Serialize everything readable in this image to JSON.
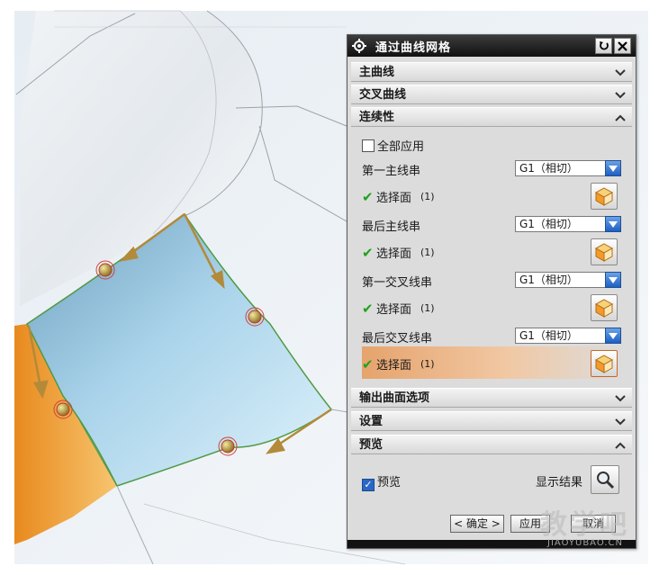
{
  "dialog": {
    "title": "通过曲线网格",
    "icon": "gear-icon",
    "reset_icon": "reset-icon",
    "close_icon": "close-icon"
  },
  "sections": {
    "primary_curves": "主曲线",
    "cross_curves": "交叉曲线",
    "continuity": "连续性",
    "output_options": "输出曲面选项",
    "settings": "设置",
    "preview": "预览"
  },
  "continuity": {
    "apply_all_label": "全部应用",
    "apply_all_checked": false,
    "rows": [
      {
        "label": "第一主线串",
        "value": "G1（相切）",
        "select_label": "选择面",
        "count": "(1)"
      },
      {
        "label": "最后主线串",
        "value": "G1（相切）",
        "select_label": "选择面",
        "count": "(1)"
      },
      {
        "label": "第一交叉线串",
        "value": "G1（相切）",
        "select_label": "选择面",
        "count": "(1)"
      },
      {
        "label": "最后交叉线串",
        "value": "G1（相切）",
        "select_label": "选择面",
        "count": "(1)"
      }
    ]
  },
  "preview": {
    "checkbox_label": "预览",
    "checked": true,
    "show_result_label": "显示结果"
  },
  "buttons": {
    "ok": "< 确定 >",
    "apply": "应用",
    "cancel": "取消"
  },
  "watermark": {
    "text": "教学吧",
    "url": "JIAOYUBAO.CN"
  },
  "colors": {
    "surface_blue": "#a9d6ec",
    "surface_orange": "#f2a33a",
    "active_highlight": "#e6a36d",
    "dropdown_blue": "#1d5fc4"
  }
}
